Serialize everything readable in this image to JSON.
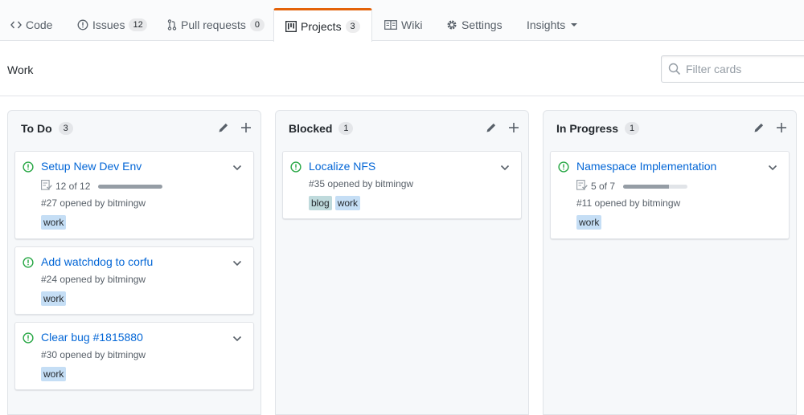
{
  "tabs": [
    {
      "label": "Code",
      "icon": "code-icon"
    },
    {
      "label": "Issues",
      "count": "12",
      "icon": "issue-icon"
    },
    {
      "label": "Pull requests",
      "count": "0",
      "icon": "pull-request-icon"
    },
    {
      "label": "Projects",
      "count": "3",
      "icon": "project-icon",
      "active": true
    },
    {
      "label": "Wiki",
      "icon": "book-icon"
    },
    {
      "label": "Settings",
      "icon": "gear-icon"
    },
    {
      "label": "Insights",
      "icon": "chevron-down-icon"
    }
  ],
  "project": {
    "name": "Work",
    "filter_placeholder": "Filter cards"
  },
  "colors": {
    "accent_tab": "#e36209",
    "link": "#0366d6",
    "open_issue": "#28a745",
    "label_work": "#c5def5",
    "label_blog": "#bfdadc"
  },
  "columns": [
    {
      "name": "To Do",
      "count": "3",
      "cards": [
        {
          "title": "Setup New Dev Env",
          "tasks": "12 of 12",
          "progress": 1.0,
          "meta": "#27 opened by bitmingw",
          "labels": [
            "work"
          ]
        },
        {
          "title": "Add watchdog to corfu",
          "meta": "#24 opened by bitmingw",
          "labels": [
            "work"
          ]
        },
        {
          "title": "Clear bug #1815880",
          "meta": "#30 opened by bitmingw",
          "labels": [
            "work"
          ]
        }
      ]
    },
    {
      "name": "Blocked",
      "count": "1",
      "cards": [
        {
          "title": "Localize NFS",
          "meta": "#35 opened by bitmingw",
          "labels": [
            "blog",
            "work"
          ]
        }
      ]
    },
    {
      "name": "In Progress",
      "count": "1",
      "cards": [
        {
          "title": "Namespace Implementation",
          "tasks": "5 of 7",
          "progress": 0.714,
          "meta": "#11 opened by bitmingw",
          "labels": [
            "work"
          ]
        }
      ]
    }
  ]
}
